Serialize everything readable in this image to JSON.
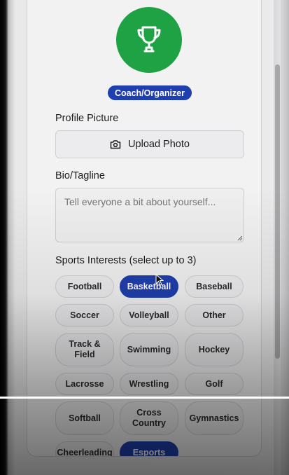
{
  "profile": {
    "role_badge": "Coach/Organizer",
    "avatar_icon": "trophy-icon",
    "avatar_color": "#1fa243"
  },
  "form": {
    "profile_picture_label": "Profile Picture",
    "upload_button_label": "Upload Photo",
    "upload_icon": "camera-icon",
    "bio_label": "Bio/Tagline",
    "bio_placeholder": "Tell everyone a bit about yourself...",
    "bio_value": "",
    "sports_label": "Sports Interests (select up to 3)"
  },
  "sports": [
    {
      "label": "Football",
      "selected": false
    },
    {
      "label": "Basketball",
      "selected": true
    },
    {
      "label": "Baseball",
      "selected": false
    },
    {
      "label": "Soccer",
      "selected": false
    },
    {
      "label": "Volleyball",
      "selected": false
    },
    {
      "label": "Other",
      "selected": false
    },
    {
      "label": "Track & Field",
      "selected": false
    },
    {
      "label": "Swimming",
      "selected": false
    },
    {
      "label": "Hockey",
      "selected": false
    },
    {
      "label": "Lacrosse",
      "selected": false
    },
    {
      "label": "Wrestling",
      "selected": false
    },
    {
      "label": "Golf",
      "selected": false
    },
    {
      "label": "Softball",
      "selected": false
    },
    {
      "label": "Cross Country",
      "selected": false
    },
    {
      "label": "Gymnastics",
      "selected": false
    },
    {
      "label": "Cheerleading",
      "selected": false
    },
    {
      "label": "Esports",
      "selected": true
    }
  ],
  "colors": {
    "accent": "#1f3fae",
    "card_bg": "#f2f2f3"
  }
}
